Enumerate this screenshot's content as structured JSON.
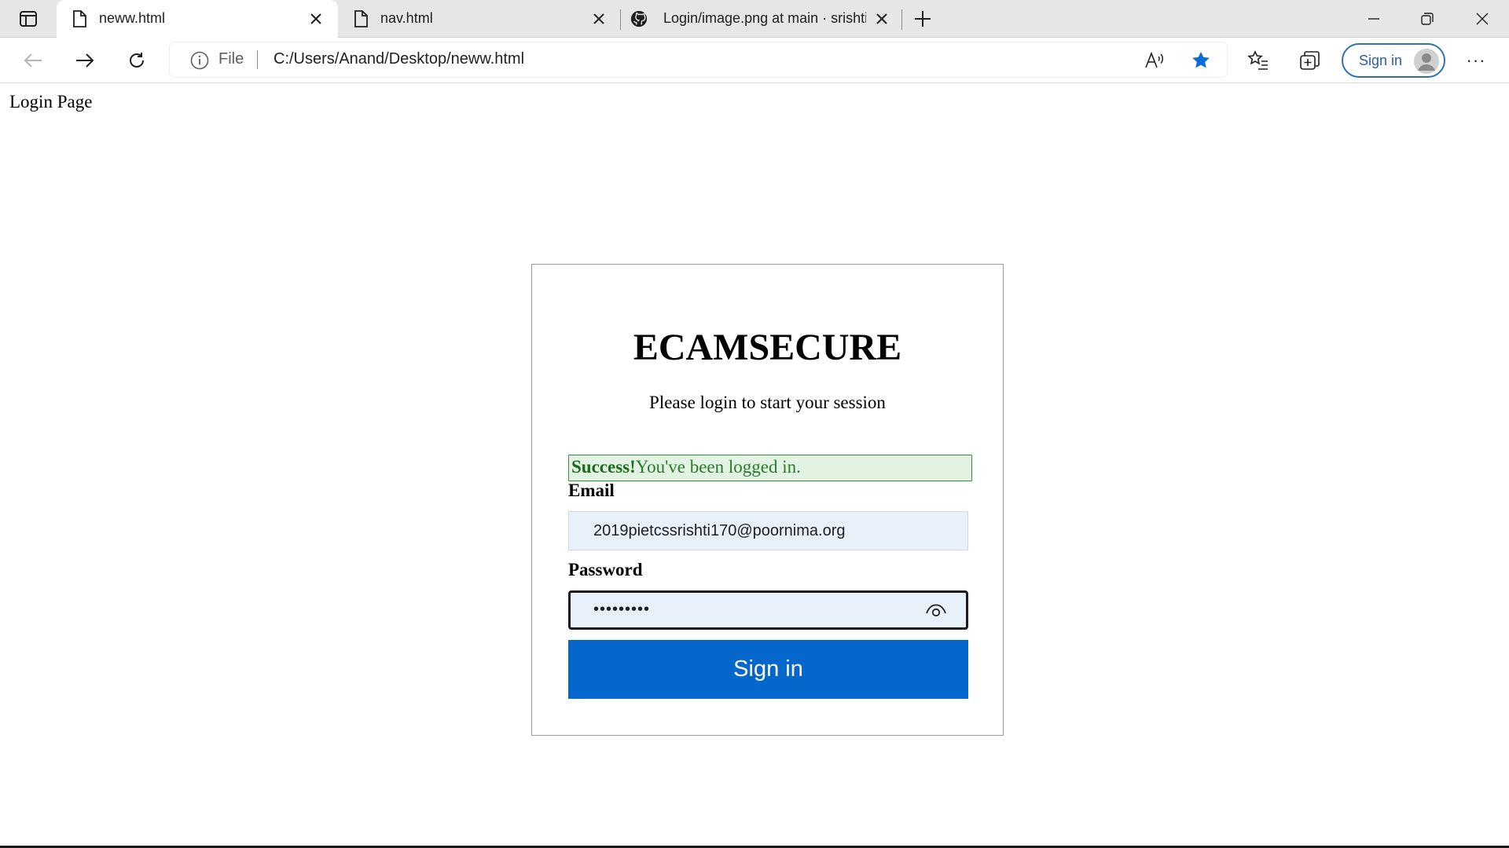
{
  "browser": {
    "tabs": [
      {
        "title": "neww.html",
        "favicon": "file-icon",
        "active": true
      },
      {
        "title": "nav.html",
        "favicon": "file-icon",
        "active": false
      },
      {
        "title": "Login/image.png at main · srishti",
        "favicon": "github-icon",
        "active": false
      }
    ],
    "toolbar": {
      "scheme": "File",
      "url": "C:/Users/Anand/Desktop/neww.html",
      "profile_label": "Sign in",
      "more_label": "···"
    },
    "colors": {
      "favorite_star": "#0a6cd6",
      "profile_border": "#2e6fb5"
    }
  },
  "page": {
    "label": "Login Page",
    "brand": "ECAMSECURE",
    "subtitle": "Please login to start your session",
    "alert": {
      "strong": "Success!",
      "text": "You've been logged in."
    },
    "email": {
      "label": "Email",
      "value": "2019pietcssrishti170@poornima.org"
    },
    "password": {
      "label": "Password",
      "masked_value": "•••••••••"
    },
    "submit_label": "Sign in",
    "colors": {
      "submit_bg": "#0566cc",
      "alert_bg": "#e3f3e3",
      "alert_text": "#2a7a2a",
      "input_bg": "#e8f0fa"
    }
  }
}
